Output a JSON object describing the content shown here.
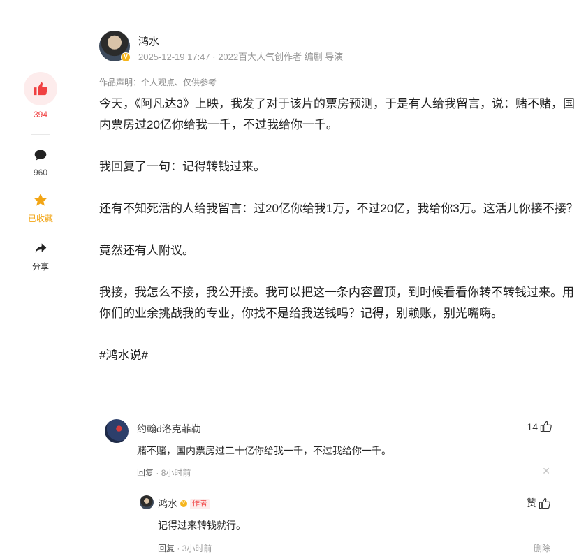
{
  "rail": {
    "like_count": "394",
    "comment_count": "960",
    "favorite_label": "已收藏",
    "share_label": "分享",
    "colors": {
      "like": "#f04142",
      "favorite": "#f2a515"
    }
  },
  "author": {
    "name": "鸿水",
    "meta": "2025-12-19 17:47 · 2022百大人气创作者 编剧 导演",
    "verified_icon": "v-badge-icon"
  },
  "declaration": "作品声明：个人观点、仅供参考",
  "article": {
    "paragraphs": [
      "今天，《阿凡达3》上映，我发了对于该片的票房预测，于是有人给我留言，说：赌不赌，国内票房过20亿你给我一千，不过我给你一千。",
      "我回复了一句：记得转钱过来。",
      "还有不知死活的人给我留言：过20亿你给我1万，不过20亿，我给你3万。这活儿你接不接？",
      "竟然还有人附议。",
      "我接，我怎么不接，我公开接。我可以把这一条内容置顶，到时候看看你转不转钱过来。用你们的业余挑战我的专业，你找不是给我送钱吗？记得，别赖账，别光嘴嗨。",
      "#鸿水说#"
    ]
  },
  "comment": {
    "name": "约翰d洛克菲勒",
    "likes": "14",
    "text": "赌不赌，国内票房过二十亿你给我一千，不过我给你一千。",
    "reply_label": "回复",
    "time": "8小时前",
    "close_glyph": "✕"
  },
  "reply": {
    "name": "鸿水",
    "author_tag": "作者",
    "like_label": "赞",
    "text": "记得过来转钱就行。",
    "reply_label": "回复",
    "time": "3小时前",
    "delete_label": "删除"
  }
}
